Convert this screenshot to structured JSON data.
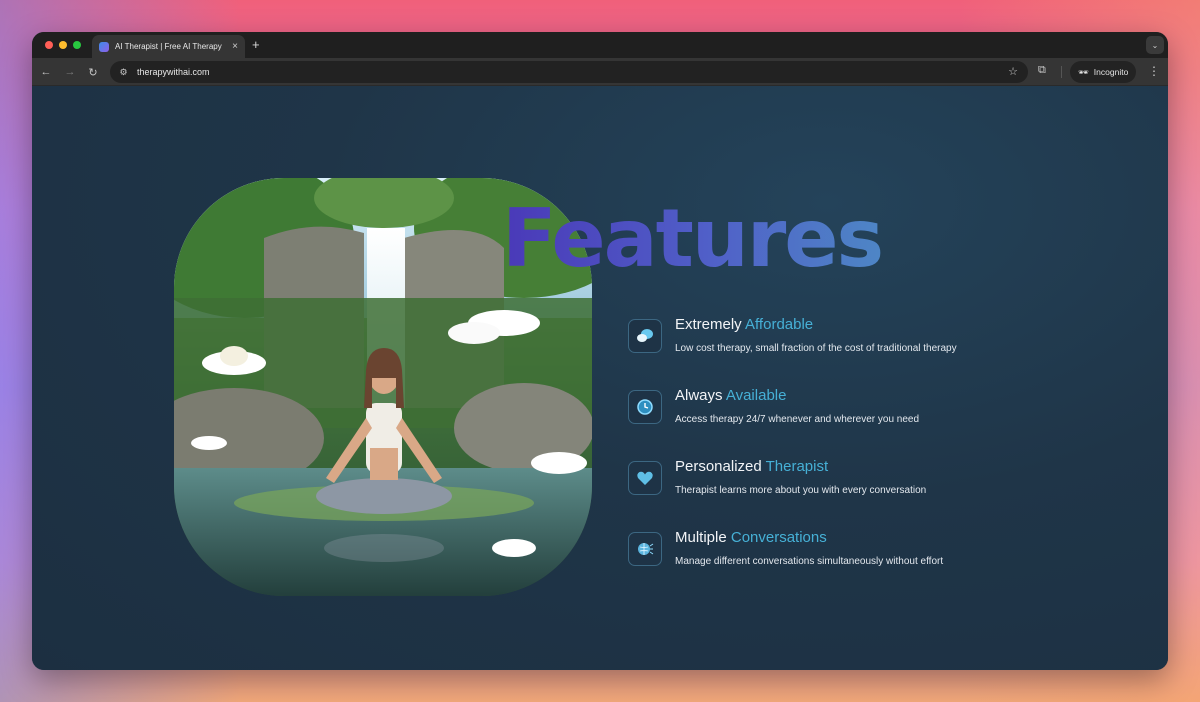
{
  "browser": {
    "tab_title": "AI Therapist | Free AI Therapy",
    "tab_close": "×",
    "new_tab": "+",
    "url": "therapywithai.com",
    "incognito_label": "Incognito"
  },
  "page": {
    "section_title": "Features",
    "hero_image_alt": "Woman meditating by a waterfall with lotus flowers",
    "features": [
      {
        "title": "Extremely",
        "accent": "Affordable",
        "description": "Low cost therapy, small fraction of the cost of traditional therapy",
        "icon": "chat-bubbles-icon"
      },
      {
        "title": "Always",
        "accent": "Available",
        "description": "Access therapy 24/7 whenever and wherever you need",
        "icon": "clock-icon"
      },
      {
        "title": "Personalized",
        "accent": "Therapist",
        "description": "Therapist learns more about you with every conversation",
        "icon": "heart-icon"
      },
      {
        "title": "Multiple",
        "accent": "Conversations",
        "description": "Manage different conversations simultaneously without effort",
        "icon": "brain-icon"
      }
    ]
  },
  "colors": {
    "accent": "#46b0d6",
    "title_gradient_start": "#4a39b8",
    "title_gradient_end": "#4e86c6",
    "page_background": "#1f3548"
  }
}
